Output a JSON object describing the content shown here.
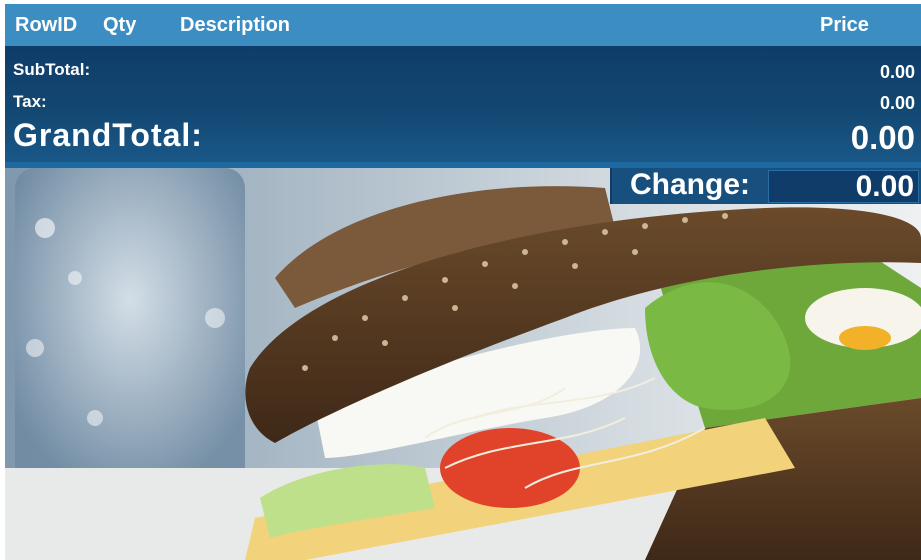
{
  "header": {
    "rowid": "RowID",
    "qty": "Qty",
    "description": "Description",
    "price": "Price"
  },
  "totals": {
    "subtotal_label": "SubTotal:",
    "subtotal_value": "0.00",
    "tax_label": "Tax:",
    "tax_value": "0.00",
    "grandtotal_label": "GrandTotal:",
    "grandtotal_value": "0.00"
  },
  "change": {
    "label": "Change:",
    "value": "0.00"
  },
  "colors": {
    "header_bg": "#3c8ec2",
    "panel_bg": "#0f3c68"
  }
}
